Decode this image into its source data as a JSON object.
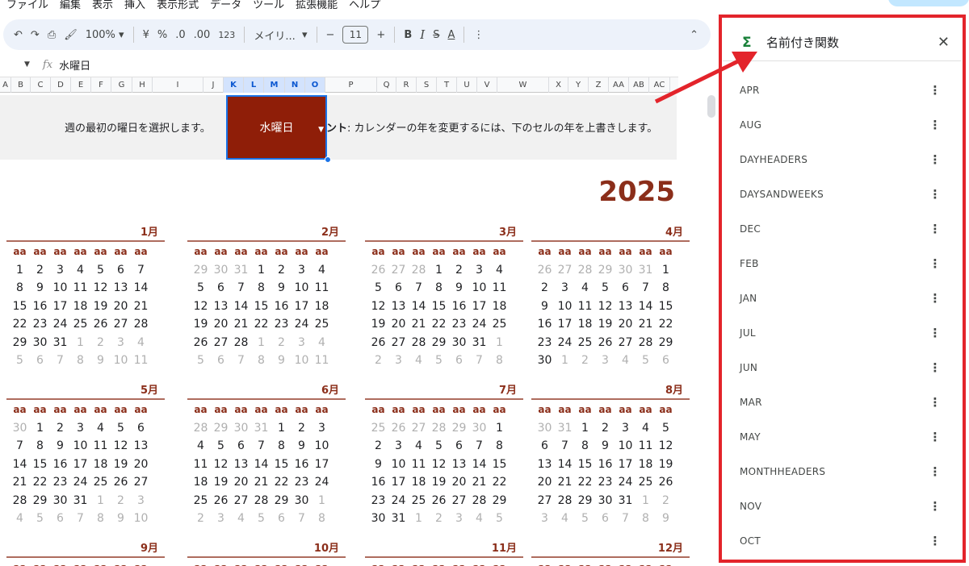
{
  "menu": [
    "ファイル",
    "編集",
    "表示",
    "挿入",
    "表示形式",
    "データ",
    "ツール",
    "拡張機能",
    "ヘルプ"
  ],
  "toolbar": {
    "zoom": "100%",
    "currency": "¥",
    "percent": "%",
    "dec_decrease": ".0",
    "dec_increase": ".00",
    "number_format": "123",
    "font": "メイリ...",
    "font_size": "11",
    "bold": "B",
    "italic": "I",
    "strike": "S",
    "text_color": "A"
  },
  "formula_bar": {
    "fx": "fx",
    "value": "水曜日"
  },
  "columns": [
    "A",
    "B",
    "C",
    "D",
    "E",
    "F",
    "G",
    "H",
    "I",
    "J",
    "K",
    "L",
    "M",
    "N",
    "O",
    "P",
    "Q",
    "R",
    "S",
    "T",
    "U",
    "V",
    "W",
    "X",
    "Y",
    "Z",
    "AA",
    "AB",
    "AC"
  ],
  "banner": {
    "left_text": "週の最初の曜日を選択します。",
    "dropdown_value": "水曜日",
    "hint_bold": "ント",
    "hint_text": ": カレンダーの年を変更するには、下のセルの年を上書きします。"
  },
  "year": "2025",
  "day_header": "aa",
  "months": [
    {
      "name": "1月",
      "lead": [],
      "days": 31,
      "trail": [
        1,
        2,
        3,
        4,
        5,
        6,
        7,
        8,
        9,
        10,
        11
      ]
    },
    {
      "name": "2月",
      "lead": [
        29,
        30,
        31
      ],
      "days": 28,
      "trail": [
        1,
        2,
        3,
        4,
        5,
        6,
        7,
        8,
        9,
        10,
        11
      ]
    },
    {
      "name": "3月",
      "lead": [
        26,
        27,
        28
      ],
      "days": 31,
      "trail": [
        1,
        2,
        3,
        4,
        5,
        6,
        7,
        8
      ]
    },
    {
      "name": "4月",
      "lead": [
        26,
        27,
        28,
        29,
        30,
        31
      ],
      "days": 30,
      "trail": [
        1,
        2,
        3,
        4,
        5,
        6
      ]
    },
    {
      "name": "5月",
      "lead": [
        30
      ],
      "days": 31,
      "trail": [
        1,
        2,
        3,
        4,
        5,
        6,
        7,
        8,
        9,
        10
      ]
    },
    {
      "name": "6月",
      "lead": [
        28,
        29,
        30,
        31
      ],
      "days": 30,
      "trail": [
        1,
        2,
        3,
        4,
        5,
        6,
        7,
        8
      ]
    },
    {
      "name": "7月",
      "lead": [
        25,
        26,
        27,
        28,
        29,
        30
      ],
      "days": 31,
      "trail": [
        1,
        2,
        3,
        4,
        5
      ]
    },
    {
      "name": "8月",
      "lead": [
        30,
        31
      ],
      "days": 31,
      "trail": [
        1,
        2,
        3,
        4,
        5,
        6,
        7,
        8,
        9
      ]
    },
    {
      "name": "9月",
      "lead": [],
      "days": 0,
      "trail": []
    },
    {
      "name": "10月",
      "lead": [],
      "days": 0,
      "trail": []
    },
    {
      "name": "11月",
      "lead": [],
      "days": 0,
      "trail": []
    },
    {
      "name": "12月",
      "lead": [],
      "days": 0,
      "trail": []
    }
  ],
  "panel": {
    "title": "名前付き関数",
    "icon": "sigma-icon",
    "items": [
      "APR",
      "AUG",
      "DAYHEADERS",
      "DAYSANDWEEKS",
      "DEC",
      "FEB",
      "JAN",
      "JUL",
      "JUN",
      "MAR",
      "MAY",
      "MONTHHEADERS",
      "NOV",
      "OCT"
    ]
  },
  "colors": {
    "accent": "#8b2e1a",
    "dropdown_bg": "#8f1e08",
    "highlight": "#e3242b",
    "toolbar_bg": "#edf2fa"
  }
}
